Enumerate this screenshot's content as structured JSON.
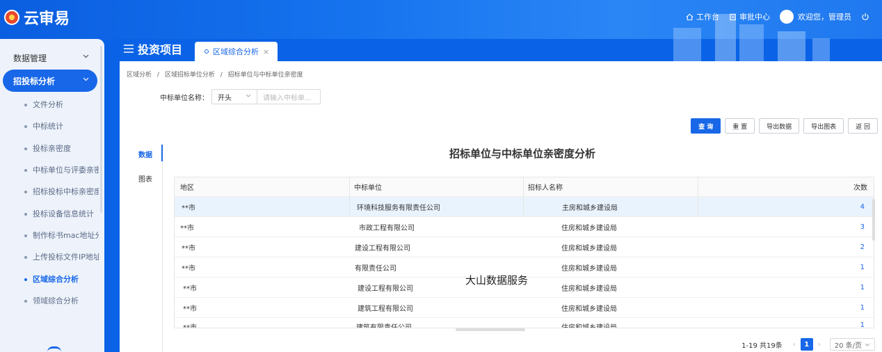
{
  "app": {
    "name": "云审易"
  },
  "topbar": {
    "workbench": "工作台",
    "approval": "审批中心",
    "welcome": "欢迎您，管理员"
  },
  "sidebar": {
    "groups": [
      {
        "label": "数据管理"
      },
      {
        "label": "招投标分析"
      }
    ],
    "items": [
      {
        "label": "文件分析"
      },
      {
        "label": "中标统计"
      },
      {
        "label": "投标亲密度"
      },
      {
        "label": "中标单位与评委亲密度"
      },
      {
        "label": "招标投标中标亲密度"
      },
      {
        "label": "投标设备信息统计"
      },
      {
        "label": "制作标书mac地址分析"
      },
      {
        "label": "上传投标文件IP地址分析"
      },
      {
        "label": "区域综合分析"
      },
      {
        "label": "领域综合分析"
      }
    ]
  },
  "header": {
    "page_title": "投资项目",
    "tab_label": "区域综合分析",
    "tab_close": "×"
  },
  "breadcrumb": {
    "items": [
      "区域分析",
      "区域招标单位分析",
      "招标单位与中标单位亲密度"
    ],
    "separator": "/"
  },
  "filter": {
    "label": "中标单位名称：",
    "match_mode": "开头",
    "placeholder": "请输入中标单..."
  },
  "toolbar": {
    "query": "查 询",
    "reset": "重 置",
    "export_data": "导出数据",
    "export_chart": "导出图表",
    "back": "返 回"
  },
  "view_tabs": {
    "data": "数据",
    "chart": "图表"
  },
  "table": {
    "title": "招标单位与中标单位亲密度分析",
    "columns": [
      "地区",
      "中标单位",
      "招标人名称",
      "次数"
    ],
    "rows": [
      [
        "**市",
        "环境科技服务有限责任公司",
        "主房和城乡建设局",
        "4"
      ],
      [
        "**市",
        "市政工程有限公司",
        "住房和城乡建设局",
        "3"
      ],
      [
        "**市",
        "建设工程有限公司",
        "住房和城乡建设局",
        "2"
      ],
      [
        "**市",
        "有限责任公司",
        "住房和城乡建设局",
        "1"
      ],
      [
        "**市",
        "建设工程有限公司",
        "住房和城乡建设局",
        "1"
      ],
      [
        "**市",
        "建筑工程有限公司",
        "住房和城乡建设局",
        "1"
      ],
      [
        "**市",
        "建筑有限责任公司",
        "住房和城乡建设局",
        "1"
      ]
    ]
  },
  "watermark": "大山数据服务",
  "pagination": {
    "summary": "1-19 共19条",
    "current": "1",
    "page_size": "20 条/页"
  }
}
